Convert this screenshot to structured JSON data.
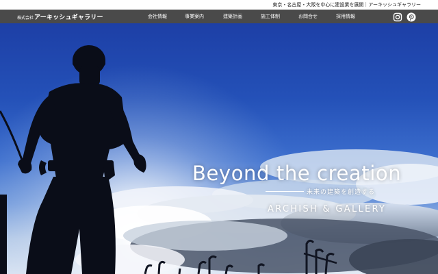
{
  "topbar": {
    "tagline": "東京・名古屋・大阪を中心に建設業を展開｜アーキッシュギャラリー"
  },
  "header": {
    "logo_corp": "株式会社",
    "logo_name": "アーキッシュギャラリー",
    "nav": [
      {
        "label": "会社情報"
      },
      {
        "label": "事業案内"
      },
      {
        "label": "建築計画"
      },
      {
        "label": "施工体制"
      },
      {
        "label": "お問合せ"
      },
      {
        "label": "採用情報"
      }
    ],
    "social": [
      {
        "icon": "instagram-icon"
      },
      {
        "icon": "pinterest-icon"
      }
    ]
  },
  "hero": {
    "title": "Beyond the creation",
    "subtitle": "未来の建築を創造する",
    "brand": "ARCHISH & GALLERY"
  },
  "colors": {
    "topbar_bg": "#ffffff",
    "navbar_bg": "#4a4a4a",
    "sky_top": "#1d3fa6",
    "sky_horizon": "#e3ebf5",
    "silhouette": "#0a0d18"
  }
}
